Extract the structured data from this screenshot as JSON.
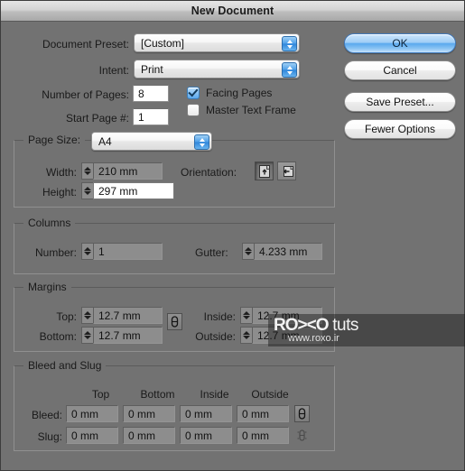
{
  "window": {
    "title": "New Document"
  },
  "buttons": {
    "ok": "OK",
    "cancel": "Cancel",
    "save_preset": "Save Preset...",
    "fewer_options": "Fewer Options"
  },
  "top": {
    "preset_label": "Document Preset:",
    "preset_value": "[Custom]",
    "intent_label": "Intent:",
    "intent_value": "Print",
    "pages_label": "Number of Pages:",
    "pages_value": "8",
    "start_page_label": "Start Page #:",
    "start_page_value": "1",
    "facing_pages_label": "Facing Pages",
    "facing_pages_checked": true,
    "master_text_frame_label": "Master Text Frame",
    "master_text_frame_checked": false
  },
  "page_size": {
    "title": "Page Size:",
    "value": "A4",
    "width_label": "Width:",
    "width_value": "210 mm",
    "height_label": "Height:",
    "height_value": "297 mm",
    "orientation_label": "Orientation:",
    "orientation_selected": "portrait"
  },
  "columns": {
    "title": "Columns",
    "number_label": "Number:",
    "number_value": "1",
    "gutter_label": "Gutter:",
    "gutter_value": "4.233 mm"
  },
  "margins": {
    "title": "Margins",
    "top_label": "Top:",
    "top_value": "12.7 mm",
    "bottom_label": "Bottom:",
    "bottom_value": "12.7 mm",
    "inside_label": "Inside:",
    "inside_value": "12.7 mm",
    "outside_label": "Outside:",
    "outside_value": "12.7 mm"
  },
  "bleed_slug": {
    "title": "Bleed and Slug",
    "columns": [
      "Top",
      "Bottom",
      "Inside",
      "Outside"
    ],
    "rows": [
      {
        "label": "Bleed:",
        "values": [
          "0 mm",
          "0 mm",
          "0 mm",
          "0 mm"
        ]
      },
      {
        "label": "Slug:",
        "values": [
          "0 mm",
          "0 mm",
          "0 mm",
          "0 mm"
        ]
      }
    ]
  },
  "watermark": {
    "brand_left": "RO",
    "brand_mid": "><",
    "brand_right": "O",
    "suffix": " tuts",
    "url": "www.roxo.ir"
  },
  "colors": {
    "dialog_bg": "#727272",
    "accent_blue": "#4e9fe8",
    "text": "#1a1a1a"
  }
}
